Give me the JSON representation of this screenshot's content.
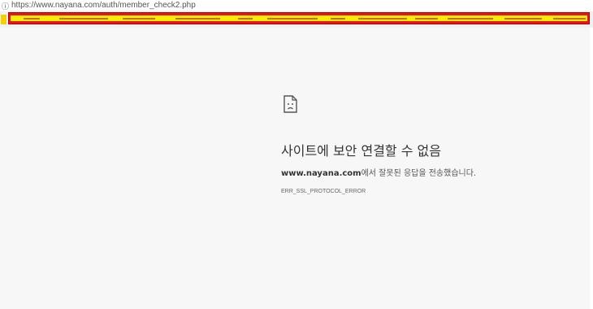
{
  "browser": {
    "url": "https://www.nayana.com/auth/member_check2.php",
    "info_icon": "info-icon"
  },
  "bookmarks": {
    "star_icon": "bookmark-star-icon",
    "redaction_color": "#e8141b",
    "highlight_color": "#f4ee00"
  },
  "error": {
    "icon": "sad-document-icon",
    "title": "사이트에 보안 연결할 수 없음",
    "host": "www.nayana.com",
    "message_suffix": "에서 잘못된 응답을 전송했습니다.",
    "code": "ERR_SSL_PROTOCOL_ERROR"
  }
}
